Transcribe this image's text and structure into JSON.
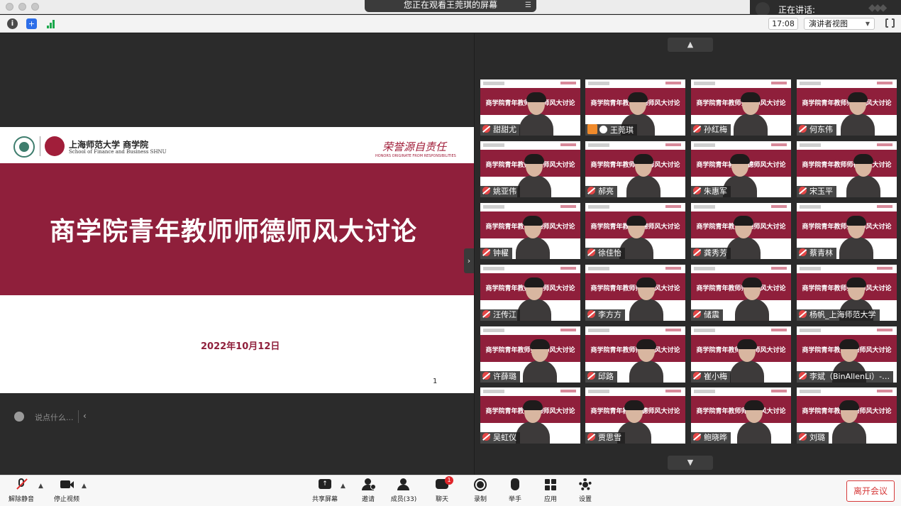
{
  "window": {
    "viewing_banner": "您正在观看王莞琪的屏幕",
    "speaker_label": "正在讲话:",
    "time": "17:08",
    "view_mode": "演讲者视图"
  },
  "slide": {
    "school_name": "上海师范大学 商学院",
    "school_name_en": "School of Finance and Business SHNU",
    "motto": "荣誉源自责任",
    "motto_en": "HONORS ORIGINATE FROM RESPONSIBILITIES",
    "title": "商学院青年教师师德师风大讨论",
    "date": "2022年10月12日",
    "page_number": "1"
  },
  "chat": {
    "placeholder": "说点什么..."
  },
  "gallery": {
    "tile_title": "商学院青年教师师德师风大讨论",
    "participants": [
      "甜甜尤",
      "王莞琪",
      "孙红梅",
      "何东伟",
      "姚亚伟",
      "郝亮",
      "朱惠军",
      "宋玉平",
      "钟櫂",
      "徐佳怡",
      "龚秀芳",
      "蔡青林",
      "汪传江",
      "李方方",
      "储震",
      "杨帆_上海师范大学",
      "许薛璐",
      "邱路",
      "崔小梅",
      "李斌（BinAllenLi）-…",
      "吴虹仪",
      "贾思雪",
      "鲍晓晔",
      "刘璐"
    ]
  },
  "controls": {
    "unmute": "解除静音",
    "stop_video": "停止视频",
    "share_screen": "共享屏幕",
    "invite": "邀请",
    "participants": "成员(33)",
    "chat": "聊天",
    "chat_badge": "1",
    "record": "录制",
    "raise_hand": "举手",
    "apps": "应用",
    "settings": "设置",
    "leave": "离开会议"
  }
}
